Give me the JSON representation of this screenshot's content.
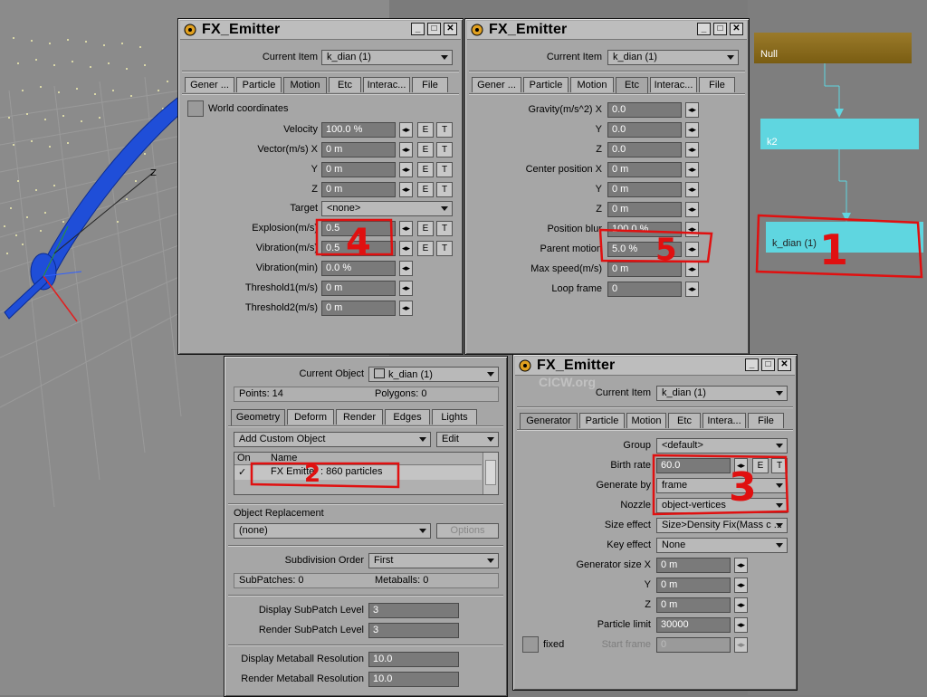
{
  "window_title": "FX_Emitter",
  "watermark": "CICW.org",
  "viewport": {
    "axis_label": "Z"
  },
  "graph": {
    "nodes": [
      "Null",
      "k2",
      "k_dian (1)"
    ]
  },
  "motion_panel": {
    "current_item_label": "Current Item",
    "current_item": "k_dian (1)",
    "tabs": [
      "Gener ...",
      "Particle",
      "Motion",
      "Etc",
      "Interac...",
      "File"
    ],
    "world_coords_label": "World coordinates",
    "rows": [
      {
        "label": "Velocity",
        "value": "100.0 %"
      },
      {
        "label": "Vector(m/s) X",
        "value": "0 m"
      },
      {
        "label": "Y",
        "value": "0 m"
      },
      {
        "label": "Z",
        "value": "0 m"
      },
      {
        "label": "Target",
        "value": "<none>"
      },
      {
        "label": "Explosion(m/s)",
        "value": "0.5"
      },
      {
        "label": "Vibration(m/s)",
        "value": "0.5"
      },
      {
        "label": "Vibration(min)",
        "value": "0.0 %"
      },
      {
        "label": "Threshold1(m/s)",
        "value": "0 m"
      },
      {
        "label": "Threshold2(m/s)",
        "value": "0 m"
      }
    ]
  },
  "etc_panel": {
    "current_item_label": "Current Item",
    "current_item": "k_dian (1)",
    "tabs": [
      "Gener ...",
      "Particle",
      "Motion",
      "Etc",
      "Interac...",
      "File"
    ],
    "rows": [
      {
        "label": "Gravity(m/s^2) X",
        "value": "0.0"
      },
      {
        "label": "Y",
        "value": "0.0"
      },
      {
        "label": "Z",
        "value": "0.0"
      },
      {
        "label": "Center position X",
        "value": "0 m"
      },
      {
        "label": "Y",
        "value": "0 m"
      },
      {
        "label": "Z",
        "value": "0 m"
      },
      {
        "label": "Position blur",
        "value": "100.0 %"
      },
      {
        "label": "Parent motion",
        "value": "5.0 %"
      },
      {
        "label": "Max speed(m/s)",
        "value": "0 m"
      },
      {
        "label": "Loop frame",
        "value": "0"
      }
    ]
  },
  "object_panel": {
    "current_object_label": "Current Object",
    "current_object": "k_dian (1)",
    "points": "Points: 14",
    "polygons": "Polygons: 0",
    "tabs": [
      "Geometry",
      "Deform",
      "Render",
      "Edges",
      "Lights"
    ],
    "add_custom": "Add Custom Object",
    "edit": "Edit",
    "list_headers": [
      "On",
      "Name"
    ],
    "list_item": {
      "check": "✓",
      "name": "FX Emitter : 860 particles"
    },
    "replacement_label": "Object Replacement",
    "replacement_value": "(none)",
    "options": "Options",
    "subdiv_label": "Subdivision Order",
    "subdiv_value": "First",
    "subpatches": "SubPatches: 0",
    "metaballs": "Metaballs: 0",
    "display_subpatch_label": "Display SubPatch Level",
    "display_subpatch": "3",
    "render_subpatch_label": "Render SubPatch Level",
    "render_subpatch": "3",
    "display_meta_label": "Display Metaball Resolution",
    "display_meta": "10.0",
    "render_meta_label": "Render Metaball Resolution",
    "render_meta": "10.0"
  },
  "generator_panel": {
    "current_item_label": "Current Item",
    "current_item": "k_dian (1)",
    "tabs": [
      "Generator",
      "Particle",
      "Motion",
      "Etc",
      "Intera...",
      "File"
    ],
    "group_label": "Group",
    "group": "<default>",
    "birth_rate_label": "Birth rate",
    "birth_rate": "60.0",
    "generate_by_label": "Generate by",
    "generate_by": "frame",
    "nozzle_label": "Nozzle",
    "nozzle": "object-vertices",
    "size_effect_label": "Size effect",
    "size_effect": "Size>Density Fix(Mass c ...",
    "key_effect_label": "Key effect",
    "key_effect": "None",
    "gen_size_x_label": "Generator size X",
    "gen_size_x": "0 m",
    "gen_size_y_label": "Y",
    "gen_size_y": "0 m",
    "gen_size_z_label": "Z",
    "gen_size_z": "0 m",
    "particle_limit_label": "Particle limit",
    "particle_limit": "30000",
    "fixed_label": "fixed",
    "start_frame_label": "Start frame",
    "start_frame": "0"
  },
  "annotations": [
    "1",
    "2",
    "3",
    "4",
    "5"
  ]
}
